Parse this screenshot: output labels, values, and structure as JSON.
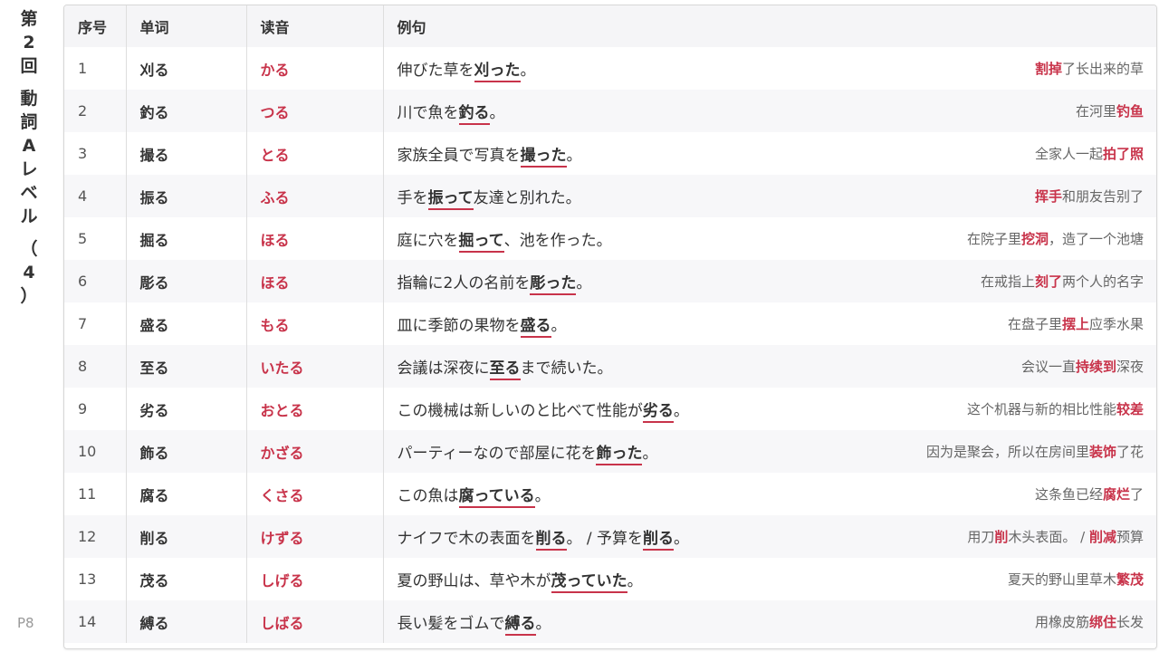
{
  "side": {
    "chars": [
      "第",
      "2",
      "回",
      "",
      "動",
      "詞",
      "A",
      "レ",
      "ベ",
      "ル",
      "",
      "（",
      "4",
      "）"
    ],
    "page": "P8"
  },
  "table": {
    "headers": [
      "序号",
      "单词",
      "读音",
      "例句"
    ],
    "rows": [
      {
        "no": "1",
        "word": "刈る",
        "reading": "かる",
        "jp": [
          {
            "t": "伸びた草を"
          },
          {
            "t": "刈った",
            "h": true
          },
          {
            "t": "。"
          }
        ],
        "cn": [
          {
            "t": "割掉",
            "h": true
          },
          {
            "t": "了长出来的草"
          }
        ]
      },
      {
        "no": "2",
        "word": "釣る",
        "reading": "つる",
        "jp": [
          {
            "t": "川で魚を"
          },
          {
            "t": "釣る",
            "h": true
          },
          {
            "t": "。"
          }
        ],
        "cn": [
          {
            "t": "在河里"
          },
          {
            "t": "钓鱼",
            "h": true
          }
        ]
      },
      {
        "no": "3",
        "word": "撮る",
        "reading": "とる",
        "jp": [
          {
            "t": "家族全員で写真を"
          },
          {
            "t": "撮った",
            "h": true
          },
          {
            "t": "。"
          }
        ],
        "cn": [
          {
            "t": "全家人一起"
          },
          {
            "t": "拍了照",
            "h": true
          }
        ]
      },
      {
        "no": "4",
        "word": "振る",
        "reading": "ふる",
        "jp": [
          {
            "t": "手を"
          },
          {
            "t": "振って",
            "h": true
          },
          {
            "t": "友達と別れた。"
          }
        ],
        "cn": [
          {
            "t": "挥手",
            "h": true
          },
          {
            "t": "和朋友告别了"
          }
        ]
      },
      {
        "no": "5",
        "word": "掘る",
        "reading": "ほる",
        "jp": [
          {
            "t": "庭に穴を"
          },
          {
            "t": "掘って",
            "h": true
          },
          {
            "t": "、池を作った。"
          }
        ],
        "cn": [
          {
            "t": "在院子里"
          },
          {
            "t": "挖洞",
            "h": true
          },
          {
            "t": "，造了一个池塘"
          }
        ]
      },
      {
        "no": "6",
        "word": "彫る",
        "reading": "ほる",
        "jp": [
          {
            "t": "指輪に2人の名前を"
          },
          {
            "t": "彫った",
            "h": true
          },
          {
            "t": "。"
          }
        ],
        "cn": [
          {
            "t": "在戒指上"
          },
          {
            "t": "刻了",
            "h": true
          },
          {
            "t": "两个人的名字"
          }
        ]
      },
      {
        "no": "7",
        "word": "盛る",
        "reading": "もる",
        "jp": [
          {
            "t": "皿に季節の果物を"
          },
          {
            "t": "盛る",
            "h": true
          },
          {
            "t": "。"
          }
        ],
        "cn": [
          {
            "t": "在盘子里"
          },
          {
            "t": "摆上",
            "h": true
          },
          {
            "t": "应季水果"
          }
        ]
      },
      {
        "no": "8",
        "word": "至る",
        "reading": "いたる",
        "jp": [
          {
            "t": "会議は深夜に"
          },
          {
            "t": "至る",
            "h": true
          },
          {
            "t": "まで続いた。"
          }
        ],
        "cn": [
          {
            "t": "会议一直"
          },
          {
            "t": "持续到",
            "h": true
          },
          {
            "t": "深夜"
          }
        ]
      },
      {
        "no": "9",
        "word": "劣る",
        "reading": "おとる",
        "jp": [
          {
            "t": "この機械は新しいのと比べて性能が"
          },
          {
            "t": "劣る",
            "h": true
          },
          {
            "t": "。"
          }
        ],
        "cn": [
          {
            "t": "这个机器与新的相比性能"
          },
          {
            "t": "较差",
            "h": true
          }
        ]
      },
      {
        "no": "10",
        "word": "飾る",
        "reading": "かざる",
        "jp": [
          {
            "t": "パーティーなので部屋に花を"
          },
          {
            "t": "飾った",
            "h": true
          },
          {
            "t": "。"
          }
        ],
        "cn": [
          {
            "t": "因为是聚会，所以在房间里"
          },
          {
            "t": "装饰",
            "h": true
          },
          {
            "t": "了花"
          }
        ]
      },
      {
        "no": "11",
        "word": "腐る",
        "reading": "くさる",
        "jp": [
          {
            "t": "この魚は"
          },
          {
            "t": "腐っている",
            "h": true
          },
          {
            "t": "。"
          }
        ],
        "cn": [
          {
            "t": "这条鱼已经"
          },
          {
            "t": "腐烂",
            "h": true
          },
          {
            "t": "了"
          }
        ]
      },
      {
        "no": "12",
        "word": "削る",
        "reading": "けずる",
        "jp": [
          {
            "t": "ナイフで木の表面を"
          },
          {
            "t": "削る",
            "h": true
          },
          {
            "t": "。 / 予算を"
          },
          {
            "t": "削る",
            "h": true
          },
          {
            "t": "。"
          }
        ],
        "cn": [
          {
            "t": "用刀"
          },
          {
            "t": "削",
            "h": true
          },
          {
            "t": "木头表面。 / "
          },
          {
            "t": "削减",
            "h": true
          },
          {
            "t": "预算"
          }
        ]
      },
      {
        "no": "13",
        "word": "茂る",
        "reading": "しげる",
        "jp": [
          {
            "t": "夏の野山は、草や木が"
          },
          {
            "t": "茂っていた",
            "h": true
          },
          {
            "t": "。"
          }
        ],
        "cn": [
          {
            "t": "夏天的野山里草木"
          },
          {
            "t": "繁茂",
            "h": true
          }
        ]
      },
      {
        "no": "14",
        "word": "縛る",
        "reading": "しばる",
        "jp": [
          {
            "t": "長い髪をゴムで"
          },
          {
            "t": "縛る",
            "h": true
          },
          {
            "t": "。"
          }
        ],
        "cn": [
          {
            "t": "用橡皮筋"
          },
          {
            "t": "绑住",
            "h": true
          },
          {
            "t": "长发"
          }
        ]
      }
    ]
  }
}
